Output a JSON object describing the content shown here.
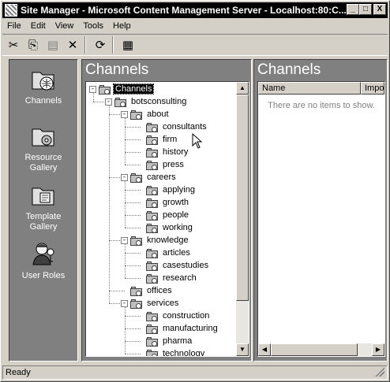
{
  "window": {
    "title": "Site Manager - Microsoft Content Management Server - Localhost:80:C...",
    "buttons": [
      "_",
      "□",
      "X"
    ]
  },
  "menu": [
    "File",
    "Edit",
    "View",
    "Tools",
    "Help"
  ],
  "toolbar": [
    {
      "icon": "scissors-icon",
      "glyph": "✂"
    },
    {
      "icon": "copy-icon",
      "glyph": "⎘"
    },
    {
      "icon": "paste-icon",
      "glyph": "▤"
    },
    {
      "icon": "delete-icon",
      "glyph": "✕"
    },
    {
      "icon": "refresh-icon",
      "glyph": "⟳"
    },
    {
      "icon": "properties-icon",
      "glyph": "▦"
    }
  ],
  "leftbar": [
    {
      "label": "Channels"
    },
    {
      "label": "Resource Gallery"
    },
    {
      "label": "Template Gallery"
    },
    {
      "label": "User Roles"
    }
  ],
  "tree_panel": {
    "heading": "Channels"
  },
  "list_panel": {
    "heading": "Channels",
    "columns": [
      "Name",
      "Impo"
    ],
    "empty_message": "There are no items to show."
  },
  "tree": [
    {
      "label": "Channels",
      "level": 0,
      "toggle": "-",
      "selected": true
    },
    {
      "label": "botsconsulting",
      "level": 1,
      "toggle": "-"
    },
    {
      "label": "about",
      "level": 2,
      "toggle": "-"
    },
    {
      "label": "consultants",
      "level": 3
    },
    {
      "label": "firm",
      "level": 3
    },
    {
      "label": "history",
      "level": 3
    },
    {
      "label": "press",
      "level": 3
    },
    {
      "label": "careers",
      "level": 2,
      "toggle": "-"
    },
    {
      "label": "applying",
      "level": 3
    },
    {
      "label": "growth",
      "level": 3
    },
    {
      "label": "people",
      "level": 3
    },
    {
      "label": "working",
      "level": 3
    },
    {
      "label": "knowledge",
      "level": 2,
      "toggle": "-"
    },
    {
      "label": "articles",
      "level": 3
    },
    {
      "label": "casestudies",
      "level": 3
    },
    {
      "label": "research",
      "level": 3
    },
    {
      "label": "offices",
      "level": 2
    },
    {
      "label": "services",
      "level": 2,
      "toggle": "-"
    },
    {
      "label": "construction",
      "level": 3
    },
    {
      "label": "manufacturing",
      "level": 3
    },
    {
      "label": "pharma",
      "level": 3
    },
    {
      "label": "technology",
      "level": 3
    }
  ],
  "status": {
    "text": "Ready"
  }
}
